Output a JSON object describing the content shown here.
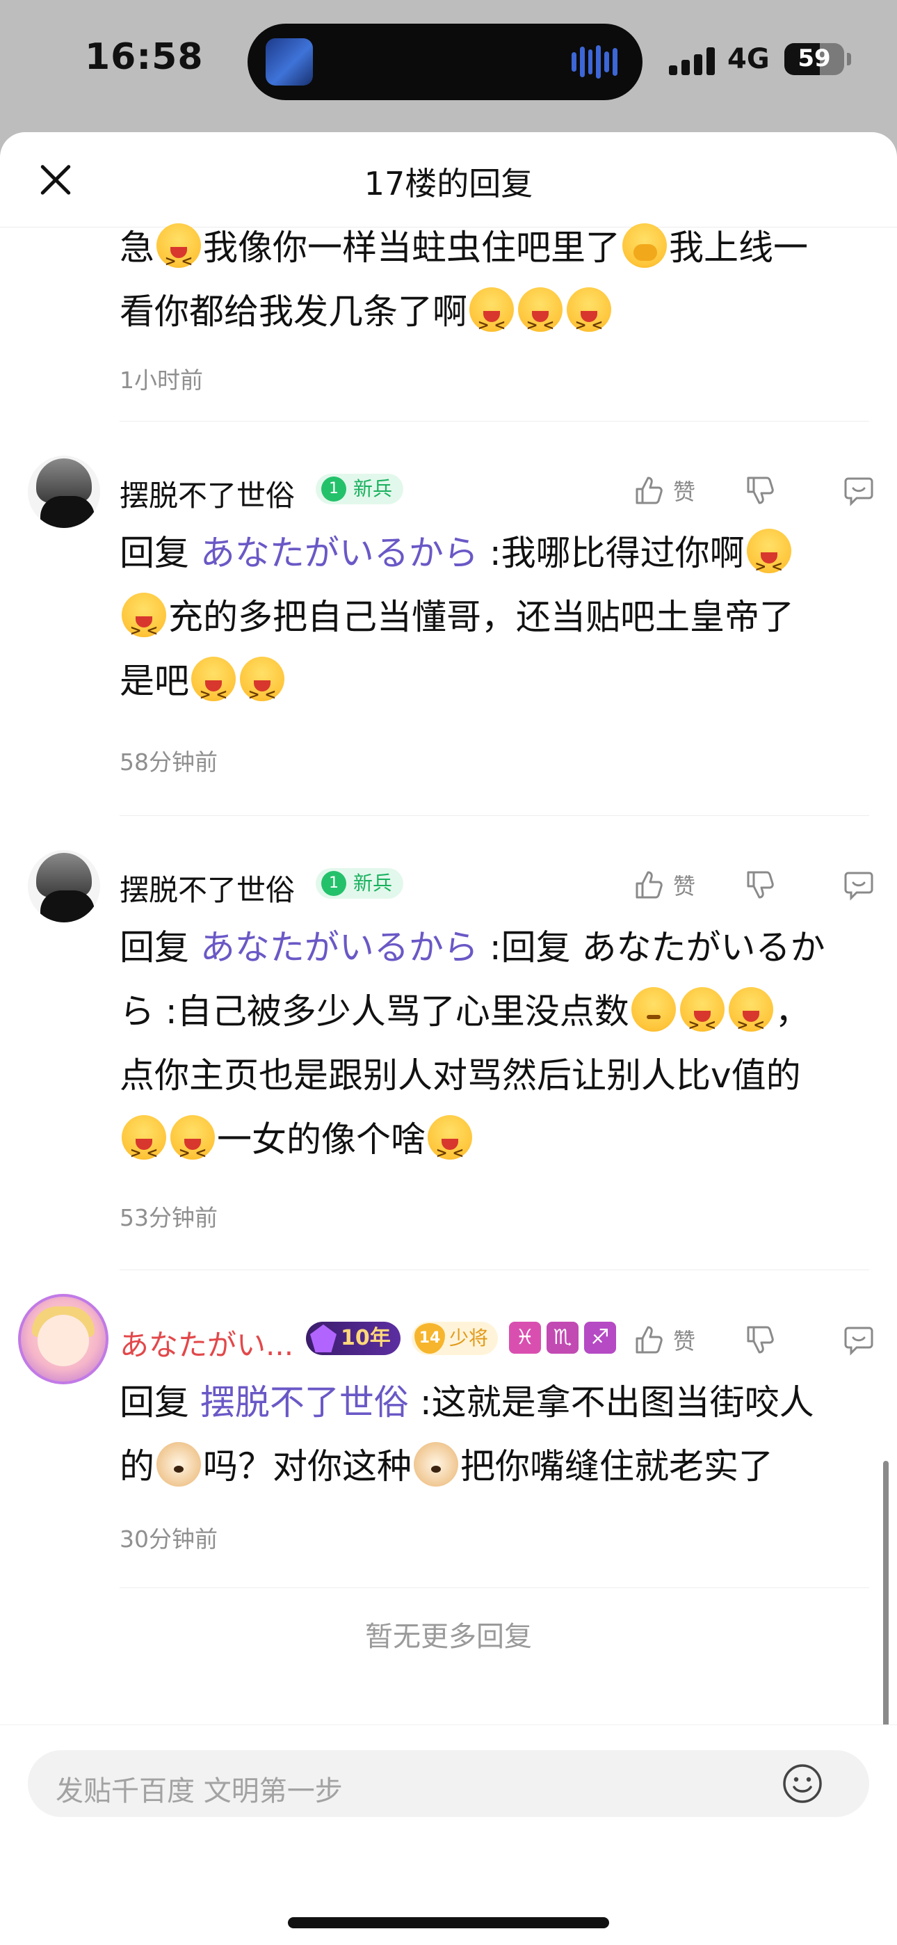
{
  "status_bar": {
    "time": "16:58",
    "network": "4G",
    "battery": "59",
    "battery_level": 0.59
  },
  "header": {
    "title": "17楼的回复"
  },
  "comments": [
    {
      "text_parts": [
        "急",
        "我像你一样当蛀虫住吧里了",
        "我上线一",
        "看你都给我发几条了啊"
      ],
      "time": "1小时前"
    },
    {
      "user": "摆脱不了世俗",
      "badge_level": "1",
      "badge_text": "新兵",
      "like_label": "赞",
      "reply_prefix": "回复",
      "mention": "あなたがいるから",
      "text_parts": [
        ":我哪比得过你啊",
        "充的多把自己当懂哥，还当贴吧土皇帝了",
        "是吧"
      ],
      "time": "58分钟前"
    },
    {
      "user": "摆脱不了世俗",
      "badge_level": "1",
      "badge_text": "新兵",
      "like_label": "赞",
      "reply_prefix": "回复",
      "mention": "あなたがいるから",
      "text_parts": [
        ":回复 あなたがいるか",
        "ら :自己被多少人骂了心里没点数",
        "，",
        "点你主页也是跟别人对骂然后让别人比v值的",
        "一女的像个啥"
      ],
      "time": "53分钟前"
    },
    {
      "user": "あなたがい...",
      "badge_year": "10年",
      "badge_rank_level": "14",
      "badge_rank_text": "少将",
      "zodiac": [
        "♓",
        "♏",
        "♐"
      ],
      "zodiac_colors": [
        "#d94fb0",
        "#c24ab3",
        "#b54ac4"
      ],
      "like_label": "赞",
      "reply_prefix": "回复",
      "mention": "摆脱不了世俗",
      "text_parts": [
        ":这就是拿不出图当街咬人",
        "的",
        "吗？对你这种",
        "把你嘴缝住就老实了"
      ],
      "time": "30分钟前"
    }
  ],
  "no_more": "暂无更多回复",
  "input": {
    "placeholder": "发贴千百度 文明第一步"
  },
  "icons": [
    "close-icon",
    "like-icon",
    "dislike-icon",
    "reply-icon",
    "emoji-icon",
    "signal-icon",
    "battery-icon"
  ]
}
